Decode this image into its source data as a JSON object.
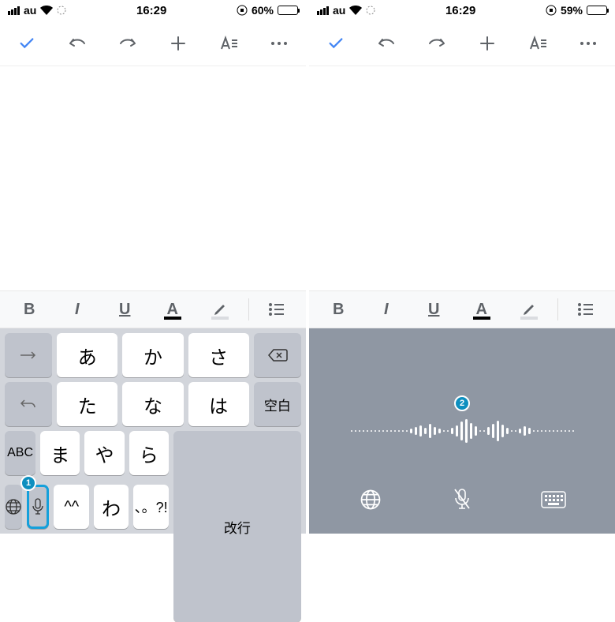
{
  "phones": [
    {
      "status": {
        "carrier": "au",
        "time": "16:29",
        "battery_pct": "60%",
        "battery_fill": 60
      },
      "keyboard": {
        "rows": [
          [
            "あ",
            "か",
            "さ"
          ],
          [
            "た",
            "な",
            "は"
          ],
          [
            "ま",
            "や",
            "ら"
          ],
          [
            "^^",
            "わ",
            "、。?!"
          ]
        ],
        "func": {
          "arrow": "→",
          "undo": "↩",
          "abc": "ABC",
          "space": "空白",
          "return": "改行"
        }
      },
      "badge": "1"
    },
    {
      "status": {
        "carrier": "au",
        "time": "16:29",
        "battery_pct": "59%",
        "battery_fill": 59
      },
      "badge": "2"
    }
  ],
  "format_bar": {
    "bold": "B",
    "italic": "I",
    "underline": "U",
    "textcolor": "A"
  }
}
